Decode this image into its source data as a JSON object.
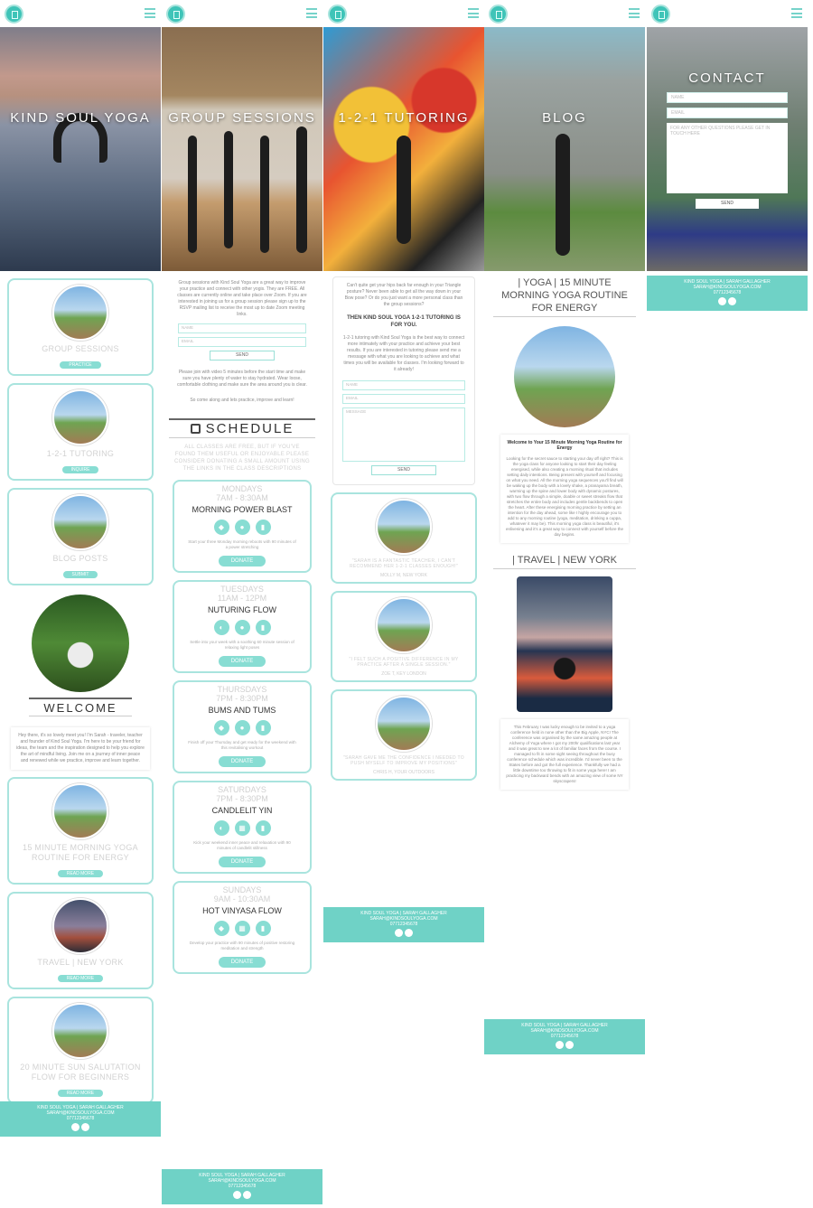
{
  "brand_color": "#6fd2c6",
  "home": {
    "hero_title": "KIND SOUL YOGA",
    "cards": [
      {
        "title": "GROUP SESSIONS",
        "button": "PRACTICE"
      },
      {
        "title": "1-2-1 TUTORING",
        "button": "INQUIRE"
      },
      {
        "title": "BLOG POSTS",
        "button": "SUBMIT"
      }
    ],
    "welcome_title": "WELCOME",
    "welcome_text": "Hey there, it's so lovely meet you! I'm Sarah - traveler, teacher and founder of Kind Soul Yoga. I'm here to be your friend for ideas, the team and the inspiration designed to help you explore the art of mindful living. Join me on a journey of inner peace and renewed while we practice, improve and learn together.",
    "posts": [
      {
        "title": "15 MINUTE MORNING YOGA ROUTINE FOR ENERGY",
        "button": "READ MORE"
      },
      {
        "title": "TRAVEL | NEW YORK",
        "button": "READ MORE"
      },
      {
        "title": "20 MINUTE SUN SALUTATION FLOW FOR BEGINNERS",
        "button": "READ MORE"
      }
    ]
  },
  "footer": {
    "line1": "KIND SOUL YOGA | SARAH GALLAGHER",
    "line2": "SARAH@KINDSOULYOGA.COM",
    "line3": "07712345678"
  },
  "group": {
    "hero_title": "GROUP SESSIONS",
    "intro": "Group sessions with Kind Soul Yoga are a great way to improve your practice and connect with other yogis. They are FREE. All classes are currently online and take place over Zoom. If you are interested in joining us for a group session please sign up to the RSVP mailing list to receive the most up to date Zoom meeting links.",
    "name_placeholder": "NAME",
    "email_placeholder": "EMAIL",
    "send": "SEND",
    "after": "Please join with video 5 minutes before the start time and make sure you have plenty of water to stay hydrated. Wear loose, comfortable clothing and make sure the area around you is clear.",
    "after2": "So come along and lets practice, improve and learn!",
    "schedule_title": "SCHEDULE",
    "schedule_note": "ALL CLASSES ARE FREE, BUT IF YOU'VE FOUND THEM USEFUL OR ENJOYABLE PLEASE CONSIDER DONATING A SMALL AMOUNT USING THE LINKS IN THE CLASS DESCRIPTIONS",
    "classes": [
      {
        "day": "MONDAYS",
        "time": "7AM - 8:30AM",
        "name": "MORNING POWER BLAST",
        "desc": "Start your three Monday morning reboots with 90 minutes of a power stretching",
        "btn": "DONATE"
      },
      {
        "day": "TUESDAYS",
        "time": "11AM - 12PM",
        "name": "NUTURING FLOW",
        "desc": "Settle into your week with a soothing 60 minute session of relaxing light poses",
        "btn": "DONATE"
      },
      {
        "day": "THURSDAYS",
        "time": "7PM - 8:30PM",
        "name": "BUMS AND TUMS",
        "desc": "Finish off your Thursday and get ready for the weekend with this revitalising workout",
        "btn": "DONATE"
      },
      {
        "day": "SATURDAYS",
        "time": "7PM - 8:30PM",
        "name": "CANDLELIT YIN",
        "desc": "Kick your weekend inner peace and relaxation with 90 minutes of candlelit stillness",
        "btn": "DONATE"
      },
      {
        "day": "SUNDAYS",
        "time": "9AM - 10:30AM",
        "name": "HOT VINYASA FLOW",
        "desc": "Develop your practice with 90 minutes of positive restoring meditation and strength",
        "btn": "DONATE"
      }
    ]
  },
  "tutoring": {
    "hero_title": "1-2-1 TUTORING",
    "intro": "Can't quite get your hips back far enough in your Triangle posture? Never been able to get all the way down in your Bow pose? Or do you just want a more personal class than the group sessions?",
    "subtitle": "THEN KIND SOUL YOGA 1-2-1 TUTORING IS FOR YOU.",
    "text": "1-2-1 tutoring with Kind Soul Yoga is the best way to connect more intimately with your practice and achieve your best results. If you are interested in tutoring please send me a message with what you are looking to achieve and what times you will be available for classes. I'm looking forward to it already!",
    "name_placeholder": "NAME",
    "email_placeholder": "EMAIL",
    "message_placeholder": "MESSAGE",
    "send": "SEND",
    "testimonials": [
      {
        "quote": "\"SARAH IS A FANTASTIC TEACHER, I CAN'T RECOMMEND HER 1-2-1 CLASSES ENOUGH!\"",
        "by": "MOLLY M, NEW YORK"
      },
      {
        "quote": "\"I FELT SUCH A POSITIVE DIFFERENCE IN MY PRACTICE AFTER A SINGLE SESSION.\"",
        "by": "ZOE T, KEY LONDON"
      },
      {
        "quote": "\"SARAH GAVE ME THE CONFIDENCE I NEEDED TO PUSH MYSELF TO IMPROVE MY POSITIONS\"",
        "by": "CHRIS H, YOUR OUTDOORS"
      }
    ]
  },
  "blog": {
    "hero_title": "BLOG",
    "post1_title": "| YOGA | 15 MINUTE MORNING YOGA ROUTINE FOR ENERGY",
    "post1_heading": "Welcome to Your 15 Minute Morning Yoga Routine for Energy",
    "post1_text": "Looking for the secret sauce to starting your day off right? This is the yoga class for anyone looking to start their day feeling energised, while also creating a morning ritual that includes setting daily intentions. Being present with yourself and focusing on what you need. All the morning yoga sequences you'll find will be waking up the body with a lovely shake, a pranayama breath, warming up the spine and lower body with dynamic postures, with two flow through a simple, doable or sweet streaks flow that stretches the entire body and includes gentle backbends to open the heart. After these energising morning practice by setting an intention for the day ahead, some like I highly encourage you to add to any morning routine (yoga, meditation, drinking a cuppa, whatever it may be). This morning yoga class is beautiful, it's enlivening and it's a great way to connect with yourself before the day begins.",
    "post2_title": "| TRAVEL | NEW YORK",
    "post2_text": "This February I was lucky enough to be invited to a yoga conference held in none other than the Big Apple, NYC! The conference was organised by the same amazing people at Alchemy of Yoga where I got my 200hr qualifications last year and it was great to see a lot of familiar faces from the course. I managed to fit in some sight seeing throughout the busy conference schedule which was incredible. I'd never been to the States before and got the full experience. Thankfully we had a little downtime too throwing to fit in some yoga here! I am practicing my backward bends with an amazing view of some NY skyscrapers!"
  },
  "contact": {
    "hero_title": "CONTACT",
    "name_placeholder": "NAME",
    "email_placeholder": "EMAIL",
    "message_placeholder": "FOR ANY OTHER QUESTIONS PLEASE GET IN TOUCH HERE",
    "send": "SEND"
  }
}
